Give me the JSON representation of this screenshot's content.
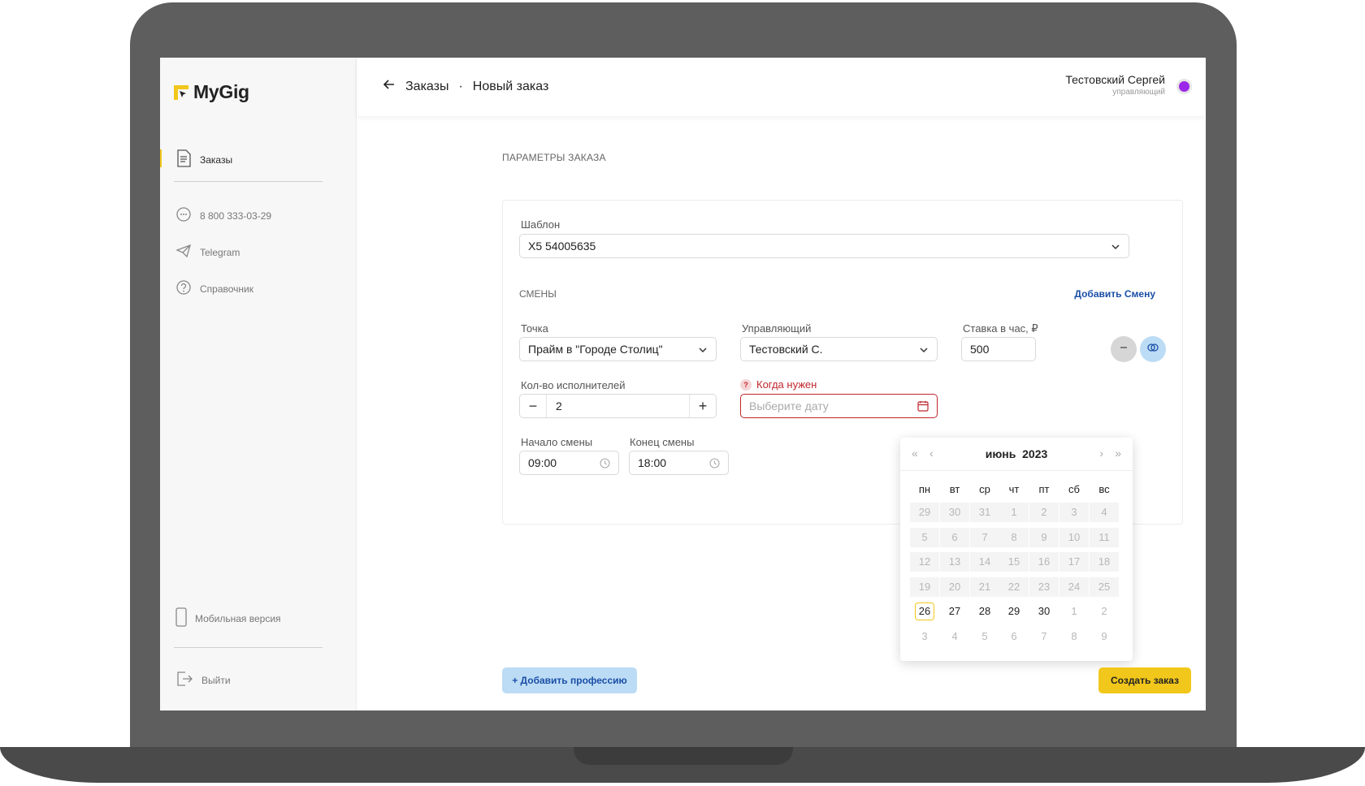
{
  "app": {
    "logo_text": "MyGig"
  },
  "sidebar": {
    "items": [
      {
        "label": "Заказы",
        "icon": "document-icon"
      },
      {
        "label": "8 800 333-03-29",
        "icon": "headset-icon"
      },
      {
        "label": "Telegram",
        "icon": "telegram-icon"
      },
      {
        "label": "Справочник",
        "icon": "help-icon"
      },
      {
        "label": "Мобильная версия",
        "icon": "phone-icon"
      },
      {
        "label": "Выйти",
        "icon": "logout-icon"
      }
    ]
  },
  "header": {
    "breadcrumb_parent": "Заказы",
    "breadcrumb_sep": "·",
    "breadcrumb_current": "Новый заказ",
    "user_name": "Тестовский Сергей",
    "user_role": "управляющий",
    "user_color": "#9b27e8"
  },
  "form": {
    "section_title": "ПАРАМЕТРЫ ЗАКАЗА",
    "template_label": "Шаблон",
    "template_value": "X5 54005635",
    "shifts_title": "СМЕНЫ",
    "add_shift": "Добавить Смену",
    "point_label": "Точка",
    "point_value": "Прайм в \"Городе Столиц\"",
    "manager_label": "Управляющий",
    "manager_value": "Тестовский С.",
    "rate_label": "Ставка в час, ₽",
    "rate_value": "500",
    "performers_label": "Кол-во исполнителей",
    "performers_value": "2",
    "minus": "−",
    "plus": "+",
    "when_label": "Когда нужен",
    "when_question": "?",
    "when_placeholder": "Выберите дату",
    "start_label": "Начало смены",
    "start_value": "09:00",
    "end_label": "Конец смены",
    "end_value": "18:00"
  },
  "calendar": {
    "month": "июнь",
    "year": "2023",
    "prev_year": "«",
    "prev_month": "‹",
    "next_month": "›",
    "next_year": "»",
    "weekdays": [
      "пн",
      "вт",
      "ср",
      "чт",
      "пт",
      "сб",
      "вс"
    ],
    "rows": [
      [
        "29",
        "30",
        "31",
        "1",
        "2",
        "3",
        "4"
      ],
      [
        "5",
        "6",
        "7",
        "8",
        "9",
        "10",
        "11"
      ],
      [
        "12",
        "13",
        "14",
        "15",
        "16",
        "17",
        "18"
      ],
      [
        "19",
        "20",
        "21",
        "22",
        "23",
        "24",
        "25"
      ],
      [
        "26",
        "27",
        "28",
        "29",
        "30",
        "1",
        "2"
      ],
      [
        "3",
        "4",
        "5",
        "6",
        "7",
        "8",
        "9"
      ]
    ],
    "today": "26"
  },
  "actions": {
    "add_profession": "+ Добавить профессию",
    "create_order": "Создать заказ"
  },
  "colors": {
    "accent": "#f2c71b",
    "link": "#1a4ea6",
    "error": "#c0272d"
  }
}
